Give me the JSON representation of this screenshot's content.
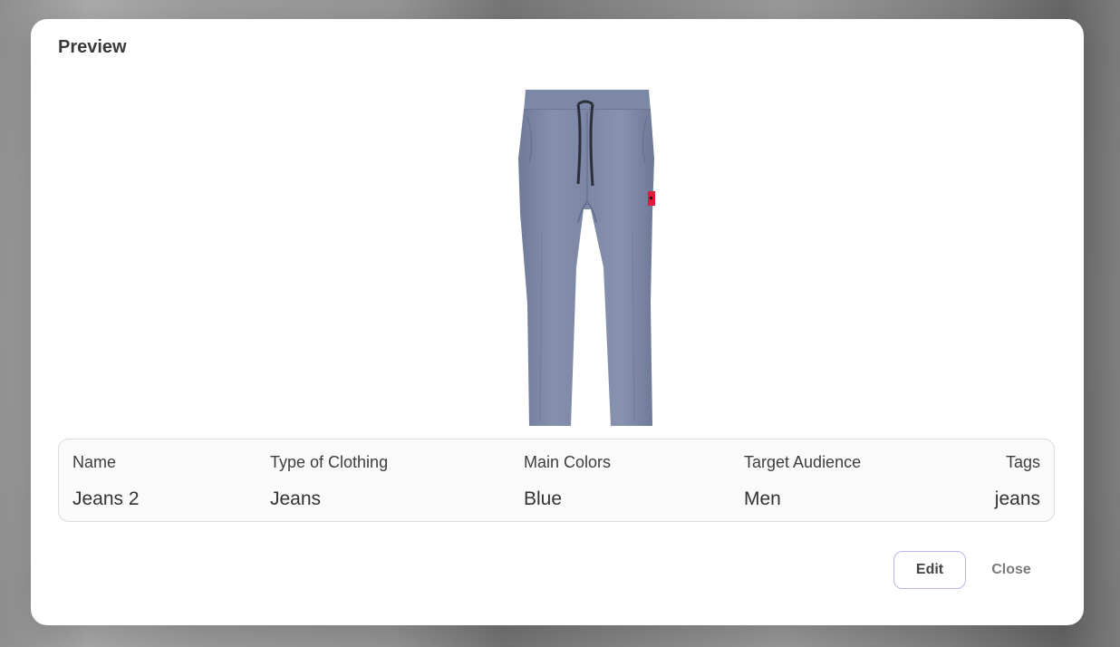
{
  "modal": {
    "title": "Preview"
  },
  "product_image": {
    "alt": "Blue jogger pants with drawstring and red tag",
    "fabric_color": "#7f8aa8",
    "tag_color": "#e01b3c",
    "drawstring_color": "#2b2f3a"
  },
  "details": {
    "columns": [
      {
        "header": "Name",
        "value": "Jeans 2"
      },
      {
        "header": "Type of Clothing",
        "value": "Jeans"
      },
      {
        "header": "Main Colors",
        "value": "Blue"
      },
      {
        "header": "Target Audience",
        "value": "Men"
      },
      {
        "header": "Tags",
        "value": "jeans"
      }
    ]
  },
  "actions": {
    "edit_label": "Edit",
    "close_label": "Close"
  },
  "colors": {
    "accent_border": "#bdb4ee",
    "modal_bg": "#ffffff"
  }
}
